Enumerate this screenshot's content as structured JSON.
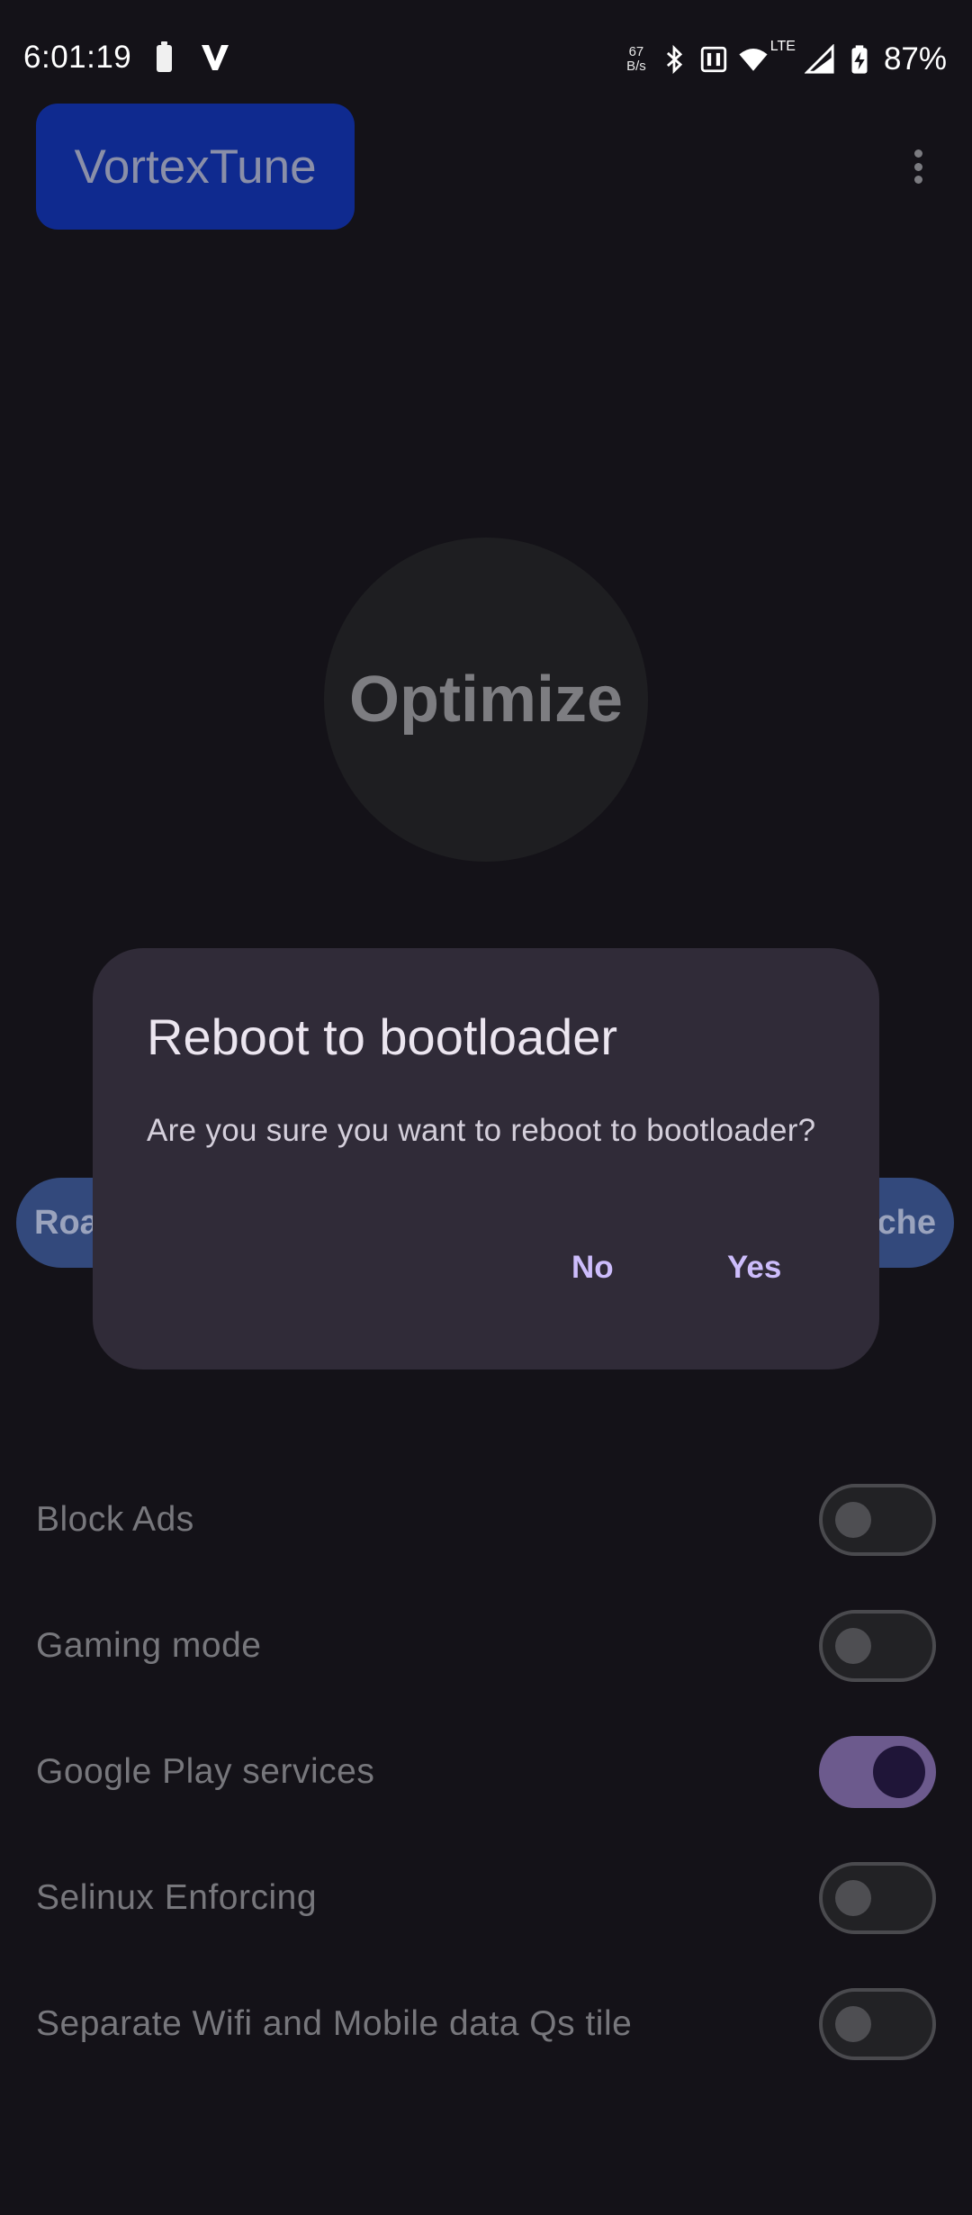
{
  "status_bar": {
    "time": "6:01:19",
    "net_speed_value": "67",
    "net_speed_unit": "B/s",
    "network_type": "LTE",
    "battery_percent": "87%",
    "icons": [
      "battery-icon",
      "v-app-icon",
      "bluetooth-icon",
      "nfc-icon",
      "wifi-icon",
      "cell-signal-icon",
      "battery-charging-icon"
    ]
  },
  "app_bar": {
    "title": "VortexTune",
    "menu_icon": "more-vert-icon"
  },
  "main": {
    "optimize_label": "Optimize",
    "chip_left_text": "Roa",
    "chip_right_text": "che"
  },
  "settings": [
    {
      "label": "Block Ads",
      "enabled": false
    },
    {
      "label": "Gaming mode",
      "enabled": false
    },
    {
      "label": "Google Play services",
      "enabled": true
    },
    {
      "label": "Selinux Enforcing",
      "enabled": false
    },
    {
      "label": "Separate Wifi and Mobile data Qs tile",
      "enabled": false
    }
  ],
  "dialog": {
    "title": "Reboot to bootloader",
    "message": "Are you sure you want to reboot to bootloader?",
    "no_label": "No",
    "yes_label": "Yes"
  },
  "colors": {
    "background": "#141218",
    "dialog_surface": "#302b38",
    "dialog_button": "#cdbdfc",
    "brand_chip": "#0f2a8f",
    "toggle_on": "#6c5a8d"
  }
}
